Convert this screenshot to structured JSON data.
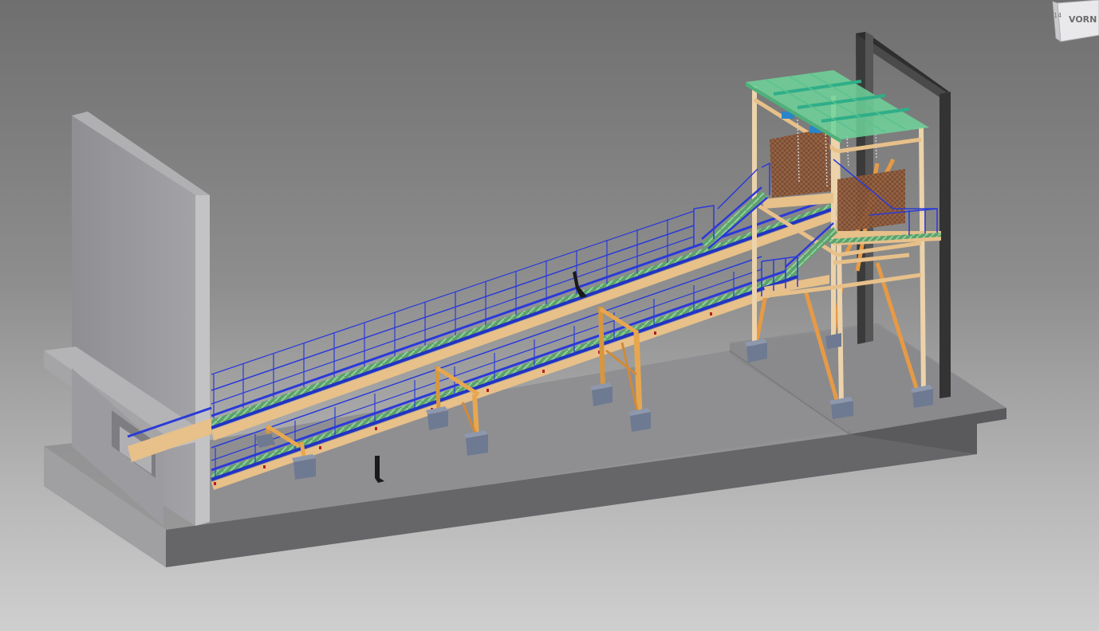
{
  "viewport": {
    "background_top": "#6f6f6f",
    "background_bottom": "#cfcfcf"
  },
  "viewcube": {
    "face_label": "VORN",
    "edge_label": "14"
  },
  "model": {
    "colors": {
      "wall": "#9a9a9e",
      "slab": "#8c8c90",
      "timber": "#e7c08a",
      "railing": "#2a3ad8",
      "grating": "#6fbf7a",
      "roof": "#6fd39a",
      "steel_frame": "#3a3a3a",
      "footing": "#6e7a92",
      "panel": "#8a5a3c"
    }
  }
}
